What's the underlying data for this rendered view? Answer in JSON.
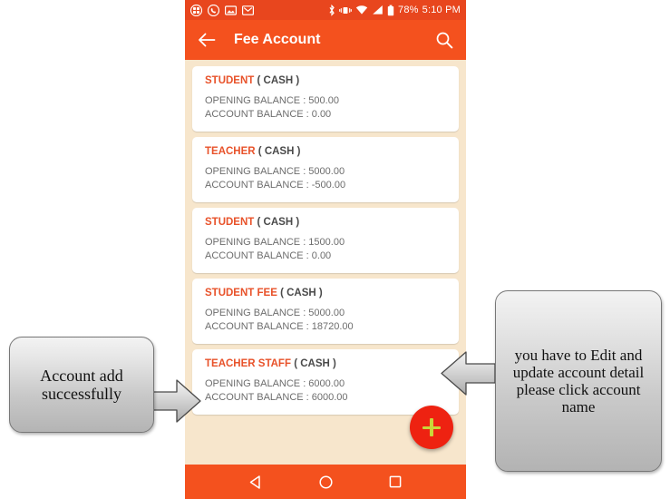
{
  "statusbar": {
    "icons_left": [
      "apps-grid-icon",
      "whatsapp-icon",
      "screenshot-icon",
      "gmail-icon"
    ],
    "icons_right": [
      "bluetooth-icon",
      "vibrate-icon",
      "wifi-icon",
      "signal-icon",
      "battery-icon"
    ],
    "battery_percent": "78%",
    "time": "5:10 PM"
  },
  "appbar": {
    "back_icon": "back-arrow-icon",
    "title": "Fee Account",
    "search_icon": "search-icon",
    "background_color": "#f4511e"
  },
  "accounts": [
    {
      "name": "STUDENT",
      "type": "( CASH )",
      "opening_balance": "OPENING BALANCE : 500.00",
      "account_balance": "ACCOUNT BALANCE : 0.00"
    },
    {
      "name": "TEACHER",
      "type": "( CASH )",
      "opening_balance": "OPENING BALANCE : 5000.00",
      "account_balance": "ACCOUNT BALANCE : -500.00"
    },
    {
      "name": "STUDENT",
      "type": "( CASH )",
      "opening_balance": "OPENING BALANCE : 1500.00",
      "account_balance": "ACCOUNT BALANCE : 0.00"
    },
    {
      "name": "STUDENT FEE",
      "type": "( CASH )",
      "opening_balance": "OPENING BALANCE : 5000.00",
      "account_balance": "ACCOUNT BALANCE : 18720.00"
    },
    {
      "name": "TEACHER STAFF",
      "type": "( CASH )",
      "opening_balance": "OPENING BALANCE : 6000.00",
      "account_balance": "ACCOUNT BALANCE : 6000.00"
    }
  ],
  "fab": {
    "icon": "plus-icon",
    "color": "#ee2211",
    "icon_color": "#c9d63a"
  },
  "navbar": {
    "back_icon": "nav-back-triangle-icon",
    "home_icon": "nav-home-circle-icon",
    "recents_icon": "nav-recents-square-icon"
  },
  "annotations": {
    "left": {
      "text": "Account add successfully",
      "arrow": "arrow-right-icon"
    },
    "right": {
      "text": "you have to Edit and update account detail please click account name",
      "arrow": "arrow-left-icon"
    }
  },
  "colors": {
    "accent": "#f4511e",
    "status_bar": "#e8461e",
    "page_background": "#f7e6cc",
    "account_name": "#e8522a"
  }
}
